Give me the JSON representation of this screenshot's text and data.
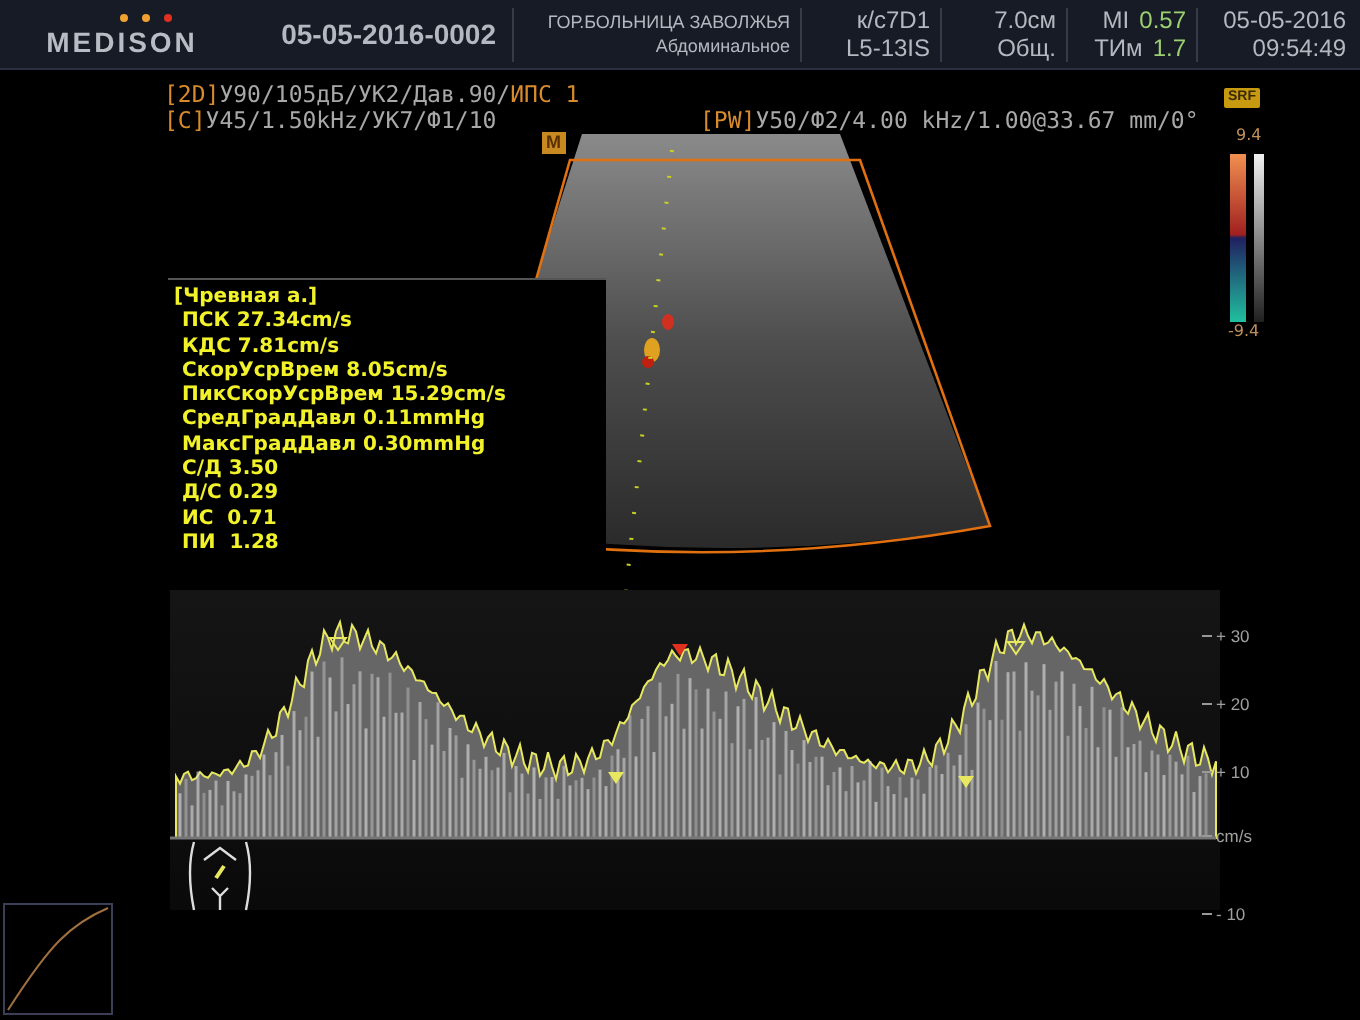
{
  "header": {
    "logo": "MEDISON",
    "patient_id": "05-05-2016-0002",
    "hospital": "ГОР.БОЛЬНИЦА ЗАВОЛЖЬЯ",
    "preset": "Абдоминальное",
    "probe": "к/с7D1",
    "probe_model": "L5-13IS",
    "depth": "7.0см",
    "mode": "Общ.",
    "mi_label": "MI",
    "mi": "0.57",
    "tim_label": "ТИм",
    "tim": "1.7",
    "date": "05-05-2016",
    "time": "09:54:49"
  },
  "params": [
    {
      "tag": "[2D]",
      "text": "У90/105дБ/УК2/Дав.90/",
      "highlight": "ИПС 1"
    },
    {
      "tag": "[C]",
      "text": "У45/1.50kHz/УК7/Ф1/10"
    },
    {
      "tag": "[PW]",
      "text": "У50/Ф2/4.00 kHz/1.00@33.67 mm/0°"
    }
  ],
  "mode_badge": "M",
  "srf_badge": "SRF",
  "color_scale": {
    "max": "9.4",
    "min": "-9.4"
  },
  "measurements": {
    "title": "[Чревная а.]",
    "lines": [
      "ПСК 27.34cm/s",
      "КДС 7.81cm/s",
      "СкорУсрВрем 8.05cm/s",
      "ПикСкорУсрВрем 15.29cm/s",
      "СредГрадДавл 0.11mmHg",
      "МаксГрадДавл 0.30mmHg",
      "С/Д 3.50",
      "Д/С 0.29",
      "ИС  0.71",
      "ПИ  1.28"
    ]
  },
  "spectrum_scale": [
    "+ 30",
    "+ 20",
    "+ 10",
    "cm/s",
    "- 10"
  ]
}
